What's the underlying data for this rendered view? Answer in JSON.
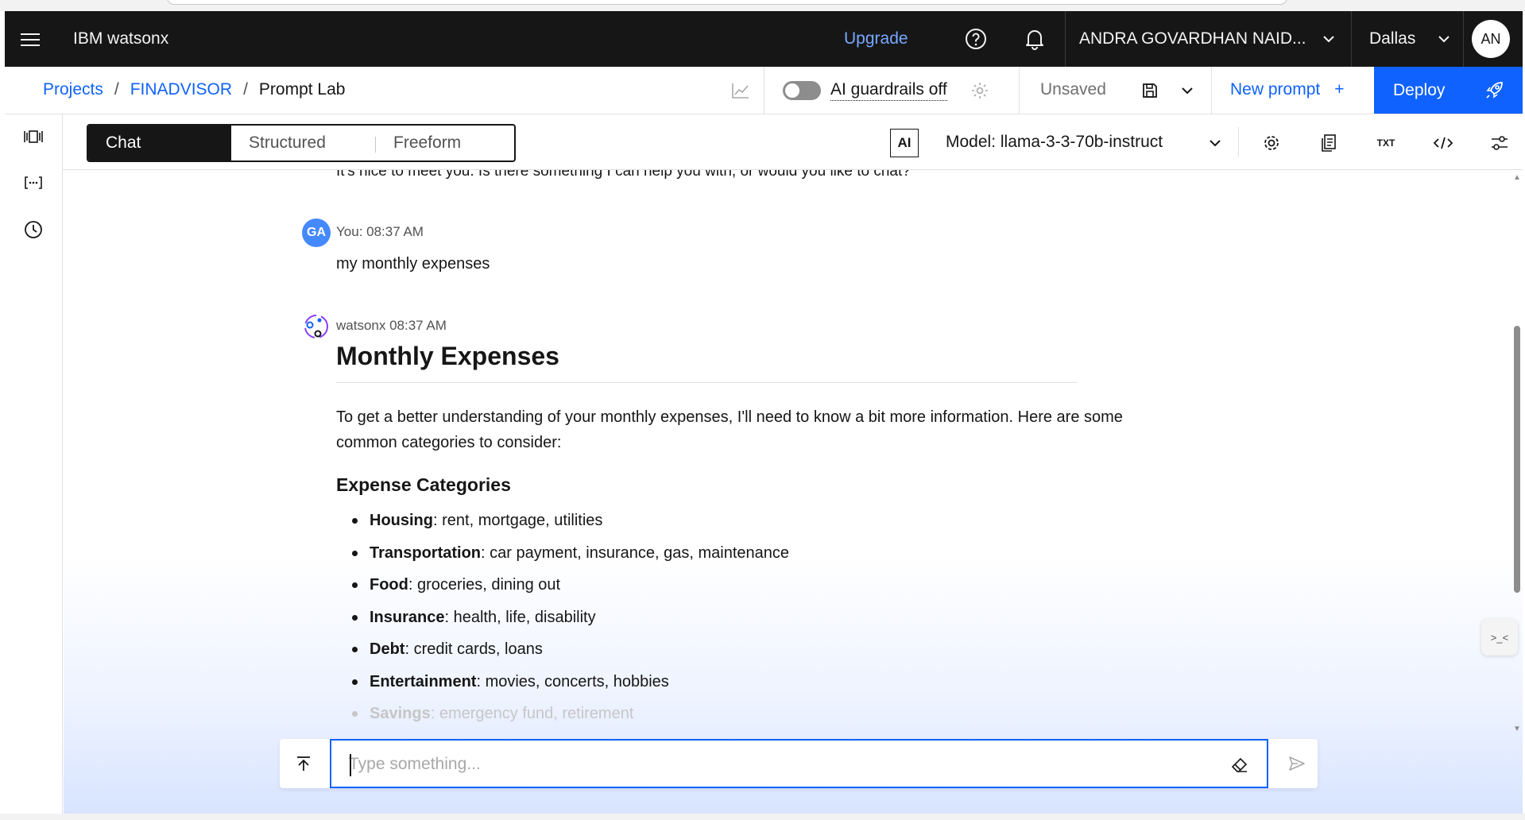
{
  "header": {
    "brand": "IBM watsonx",
    "upgrade": "Upgrade",
    "account": "ANDRA GOVARDHAN NAID...",
    "region": "Dallas",
    "avatar_initials": "AN"
  },
  "breadcrumb": {
    "projects": "Projects",
    "sep1": "/",
    "project": "FINADVISOR",
    "sep2": "/",
    "current": "Prompt Lab"
  },
  "subheader": {
    "guardrails_label": "AI guardrails off",
    "guardrails_on": false,
    "save_status": "Unsaved",
    "new_prompt": "New prompt",
    "new_prompt_plus": "+",
    "deploy": "Deploy"
  },
  "toolbar": {
    "modes": [
      "Chat",
      "Structured",
      "Freeform"
    ],
    "active_mode": "Chat",
    "ai_badge": "AI",
    "model_label": "Model: llama-3-3-70b-instruct",
    "txt_badge": "TXT"
  },
  "chat": {
    "prev_bot_text": "It's nice to meet you. Is there something I can help you with, or would you like to chat?",
    "user": {
      "initials": "GA",
      "header": "You: 08:37 AM",
      "text": "my monthly expenses"
    },
    "bot": {
      "header": "watsonx 08:37 AM",
      "heading": "Monthly Expenses",
      "intro": "To get a better understanding of your monthly expenses, I'll need to know a bit more information. Here are some common categories to consider:",
      "subheading": "Expense Categories",
      "categories": [
        {
          "name": "Housing",
          "detail": ": rent, mortgage, utilities"
        },
        {
          "name": "Transportation",
          "detail": ": car payment, insurance, gas, maintenance"
        },
        {
          "name": "Food",
          "detail": ": groceries, dining out"
        },
        {
          "name": "Insurance",
          "detail": ": health, life, disability"
        },
        {
          "name": "Debt",
          "detail": ": credit cards, loans"
        },
        {
          "name": "Entertainment",
          "detail": ": movies, concerts, hobbies"
        },
        {
          "name": "Savings",
          "detail": ": emergency fund, retirement"
        }
      ]
    }
  },
  "input": {
    "placeholder": "Type something...",
    "value": ""
  },
  "side_chip": ">_<",
  "colors": {
    "header_bg": "#161616",
    "accent": "#0f62fe",
    "upgrade": "#78a9ff"
  }
}
